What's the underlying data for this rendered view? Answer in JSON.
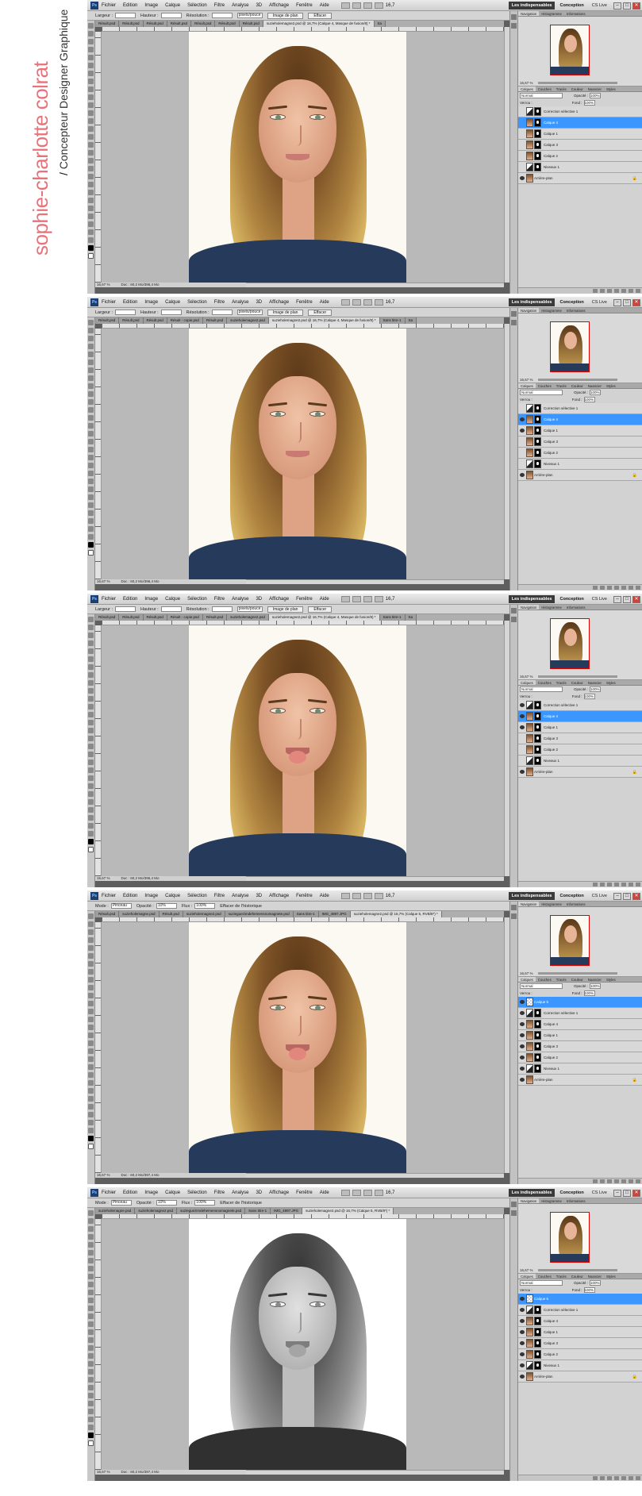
{
  "brand": {
    "name": "sophie-charlotte colrat",
    "slash": "/",
    "tagline": "Concepteur Designer Graphique"
  },
  "app": {
    "menu": [
      "Fichier",
      "Edition",
      "Image",
      "Calque",
      "Sélection",
      "Filtre",
      "Analyse",
      "3D",
      "Affichage",
      "Fenêtre",
      "Aide"
    ],
    "zoom": "16,7",
    "workspace_active": "Les indispensables",
    "workspace_other": "Conception",
    "cslive": "CS Live",
    "ps_logo": "Ps",
    "win_min": "–",
    "win_max": "□",
    "win_close": "✕",
    "status_zoom": "16,67 %",
    "nav_zoom": "16,67 %"
  },
  "options_crop": {
    "largeur": "Largeur :",
    "hauteur": "Hauteur :",
    "resolution": "Résolution :",
    "unit": "pixels/pouce",
    "image_avant": "Image de plan",
    "effacer": "Effacer"
  },
  "options_brush": {
    "mode_label": "Mode :",
    "mode_value": "Pinceau",
    "opacite_label": "Opacité :",
    "opacite_value": "10%",
    "flux_label": "Flux :",
    "flux_value": "100%",
    "effacer_historique": "Effacer de l'historique"
  },
  "panel_tabs": [
    "Navigation",
    "Histogramme",
    "Informations"
  ],
  "layer_tabs": [
    "Calques",
    "Couches",
    "Tracés",
    "Couleur",
    "Nuancier",
    "Styles"
  ],
  "layers_props": {
    "mode": "Normal",
    "opacite_label": "Opacité :",
    "opacite": "100%",
    "verrou": "Verrou :",
    "fond_label": "Fond :",
    "fond": "100%"
  },
  "screens": [
    {
      "options": "crop",
      "tabs": [
        "Résult.psd",
        "Résult.psd",
        "Résult.psd",
        "Résult.psd",
        "Résult.psd",
        "Résult.psd",
        "Résult.psd",
        "suzieholemagne2.psd @ 16,7% (Calque 4, Masque de fusion/8) *",
        "Sa"
      ],
      "doc": "Doc : 60,2 Mo/396,4 Mo",
      "photo": "neutral",
      "layers": [
        {
          "name": "Correction sélective 1",
          "thumb": "adj",
          "mask": true,
          "visible": false,
          "selected": false
        },
        {
          "name": "Calque 4",
          "thumb": "photo",
          "mask": true,
          "visible": false,
          "selected": true
        },
        {
          "name": "Calque 1",
          "thumb": "photo",
          "mask": true,
          "visible": false,
          "selected": false
        },
        {
          "name": "Calque 3",
          "thumb": "photo",
          "mask": true,
          "visible": false,
          "selected": false
        },
        {
          "name": "Calque 2",
          "thumb": "photo",
          "mask": true,
          "visible": false,
          "selected": false
        },
        {
          "name": "Niveaux 1",
          "thumb": "adj",
          "mask": true,
          "visible": false,
          "selected": false
        },
        {
          "name": "Arrière-plan",
          "thumb": "photo",
          "mask": false,
          "visible": true,
          "selected": false,
          "lock": true
        }
      ]
    },
    {
      "options": "crop",
      "tabs": [
        "Résult.psd",
        "Résult.psd",
        "Résult.psd",
        "Résult - copie.psd",
        "Résult.psd",
        "suzieholemagne2.psd",
        "suzieholemagne2.psd @ 16,7% (Calque 4, Masque de fusion/8) *",
        "Sans titre-1",
        "Sa"
      ],
      "doc": "Doc : 60,2 Mo/396,4 Mo",
      "photo": "neutral",
      "layers": [
        {
          "name": "Correction sélective 1",
          "thumb": "adj",
          "mask": true,
          "visible": false,
          "selected": false
        },
        {
          "name": "Calque 4",
          "thumb": "photo",
          "mask": true,
          "visible": true,
          "selected": true
        },
        {
          "name": "Calque 1",
          "thumb": "photo",
          "mask": true,
          "visible": true,
          "selected": false
        },
        {
          "name": "Calque 3",
          "thumb": "photo",
          "mask": true,
          "visible": false,
          "selected": false
        },
        {
          "name": "Calque 2",
          "thumb": "photo",
          "mask": true,
          "visible": false,
          "selected": false
        },
        {
          "name": "Niveaux 1",
          "thumb": "adj",
          "mask": true,
          "visible": false,
          "selected": false
        },
        {
          "name": "Arrière-plan",
          "thumb": "photo",
          "mask": false,
          "visible": true,
          "selected": false,
          "lock": true
        }
      ]
    },
    {
      "options": "crop",
      "tabs": [
        "Résult.psd",
        "Résult.psd",
        "Résult.psd",
        "Résult - copie.psd",
        "Résult.psd",
        "suzieholemagne2.psd",
        "suzieholemagne2.psd @ 16,7% (Calque 4, Masque de fusion/8) *",
        "Sans titre-1",
        "Sa"
      ],
      "doc": "Doc : 60,2 Mo/396,4 Mo",
      "photo": "pout",
      "layers": [
        {
          "name": "Correction sélective 1",
          "thumb": "adj",
          "mask": true,
          "visible": true,
          "selected": false
        },
        {
          "name": "Calque 4",
          "thumb": "photo",
          "mask": true,
          "visible": true,
          "selected": true
        },
        {
          "name": "Calque 1",
          "thumb": "photo",
          "mask": true,
          "visible": true,
          "selected": false
        },
        {
          "name": "Calque 3",
          "thumb": "photo",
          "mask": true,
          "visible": false,
          "selected": false
        },
        {
          "name": "Calque 2",
          "thumb": "photo",
          "mask": true,
          "visible": false,
          "selected": false
        },
        {
          "name": "Niveaux 1",
          "thumb": "adj",
          "mask": true,
          "visible": false,
          "selected": false
        },
        {
          "name": "Arrière-plan",
          "thumb": "photo",
          "mask": false,
          "visible": true,
          "selected": false,
          "lock": true
        }
      ]
    },
    {
      "options": "brush",
      "tabs": [
        "Résult.psd",
        "suzieholemagne.psd",
        "Résult.psd",
        "suzieholemagne2.psd",
        "suzieguezimdehemensnomagnete.psd",
        "Sans titre-1",
        "IMG_4897.JPG",
        "suzieholemagne2.psd @ 16,7% (Calque 5, RVB/8*) *"
      ],
      "doc": "Doc : 60,2 Mo/397,4 Mo",
      "photo": "pout",
      "layers": [
        {
          "name": "Calque 5",
          "thumb": "blank",
          "mask": false,
          "visible": true,
          "selected": true
        },
        {
          "name": "Correction sélective 1",
          "thumb": "adj",
          "mask": true,
          "visible": true,
          "selected": false
        },
        {
          "name": "Calque 4",
          "thumb": "photo",
          "mask": true,
          "visible": true,
          "selected": false
        },
        {
          "name": "Calque 1",
          "thumb": "photo",
          "mask": true,
          "visible": true,
          "selected": false
        },
        {
          "name": "Calque 3",
          "thumb": "photo",
          "mask": true,
          "visible": true,
          "selected": false
        },
        {
          "name": "Calque 2",
          "thumb": "photo",
          "mask": true,
          "visible": true,
          "selected": false
        },
        {
          "name": "Niveaux 1",
          "thumb": "adj",
          "mask": true,
          "visible": true,
          "selected": false
        },
        {
          "name": "Arrière-plan",
          "thumb": "photo",
          "mask": false,
          "visible": true,
          "selected": false,
          "lock": true
        }
      ]
    },
    {
      "options": "brush",
      "tabs": [
        "suzieholemagne.psd",
        "suzieholemagne2.psd",
        "suzieguezimdehemensnomagnete.psd",
        "Sans titre-1",
        "IMG_4897.JPG",
        "suzieholemagne2.psd @ 16,7% (Calque 5, RVB/8*) *"
      ],
      "doc": "Doc : 60,2 Mo/397,4 Mo",
      "photo": "bw",
      "layers": [
        {
          "name": "Calque 5",
          "thumb": "blank",
          "mask": false,
          "visible": true,
          "selected": true
        },
        {
          "name": "Correction sélective 1",
          "thumb": "adj",
          "mask": true,
          "visible": true,
          "selected": false
        },
        {
          "name": "Calque 4",
          "thumb": "photo",
          "mask": true,
          "visible": true,
          "selected": false
        },
        {
          "name": "Calque 1",
          "thumb": "photo",
          "mask": true,
          "visible": true,
          "selected": false
        },
        {
          "name": "Calque 3",
          "thumb": "photo",
          "mask": true,
          "visible": true,
          "selected": false
        },
        {
          "name": "Calque 2",
          "thumb": "photo",
          "mask": true,
          "visible": true,
          "selected": false
        },
        {
          "name": "Niveaux 1",
          "thumb": "adj",
          "mask": true,
          "visible": true,
          "selected": false
        },
        {
          "name": "Arrière-plan",
          "thumb": "photo",
          "mask": false,
          "visible": true,
          "selected": false,
          "lock": true
        }
      ]
    }
  ],
  "colors": {
    "accent": "#3b97ff",
    "brand": "#e8727a",
    "shirt": "#263a5c",
    "nav_frame": "#e00000"
  }
}
